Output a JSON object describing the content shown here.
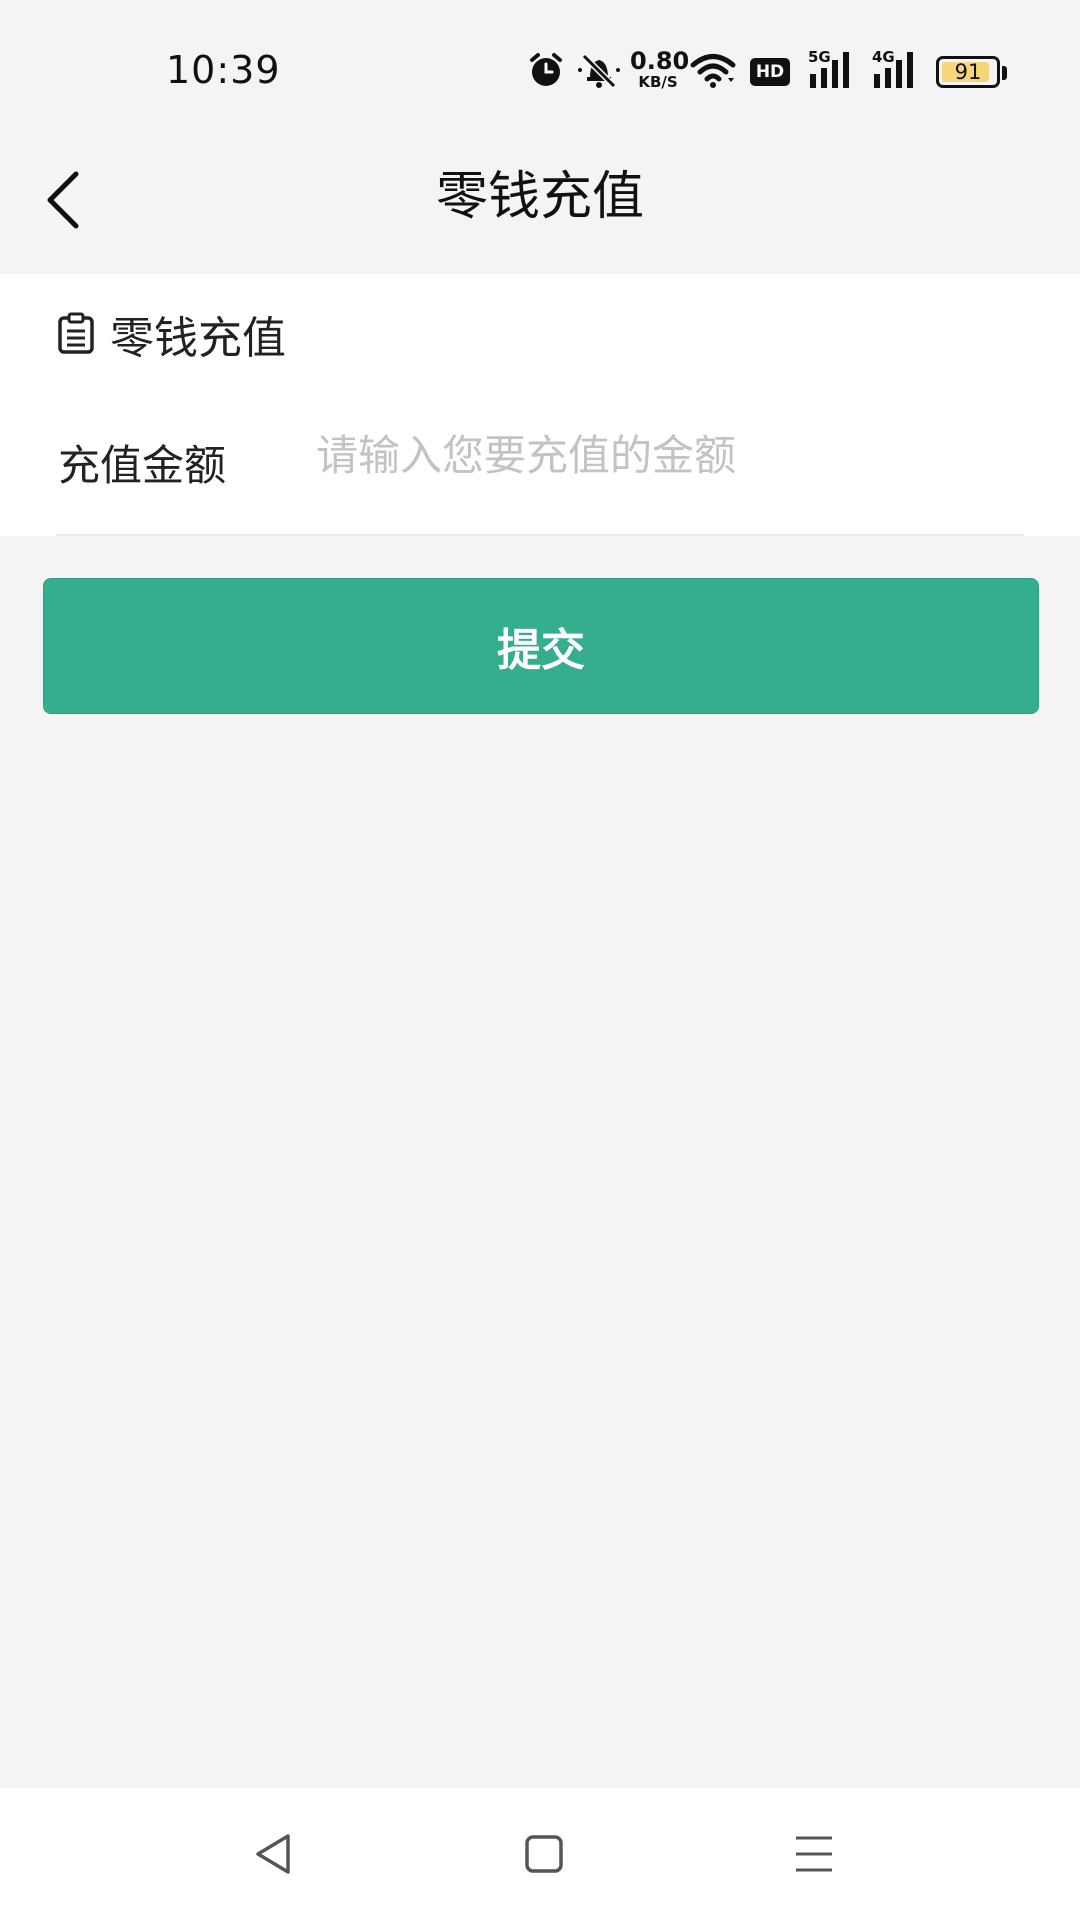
{
  "status_bar": {
    "time": "10:39",
    "net_speed_value": "0.80",
    "net_speed_unit": "KB/S",
    "hd_label": "HD",
    "signal_5g": "5G",
    "signal_4g": "4G",
    "battery_level": "91",
    "battery_fraction": 0.91,
    "icons": [
      "alarm-icon",
      "mute-bell-icon",
      "wifi-icon",
      "hd-icon",
      "signal-5g-icon",
      "signal-4g-icon",
      "battery-icon"
    ]
  },
  "header": {
    "title": "零钱充值",
    "back_icon": "chevron-left-icon"
  },
  "form": {
    "section_icon": "clipboard-list-icon",
    "section_title": "零钱充值",
    "amount_label": "充值金额",
    "amount_value": "",
    "amount_placeholder": "请输入您要充值的金额"
  },
  "submit_label": "提交",
  "colors": {
    "accent": "#35ad8f",
    "background": "#f4f4f5",
    "card": "#ffffff",
    "placeholder": "#c3c3c5",
    "battery_fill": "#f6d57b"
  },
  "system_nav": {
    "icons": [
      "nav-back-triangle-icon",
      "nav-home-square-icon",
      "nav-menu-lines-icon"
    ]
  }
}
